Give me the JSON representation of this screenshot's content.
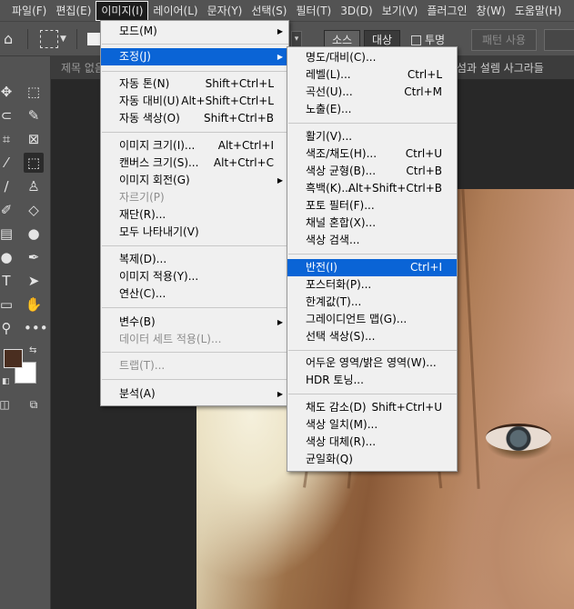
{
  "menubar": {
    "items": [
      "파일(F)",
      "편집(E)",
      "이미지(I)",
      "레이어(L)",
      "문자(Y)",
      "선택(S)",
      "필터(T)",
      "3D(D)",
      "보기(V)",
      "플러그인",
      "창(W)",
      "도움말(H)"
    ]
  },
  "options": {
    "seg1": "소스",
    "seg2": "대상",
    "transparent_label": "투명",
    "pattern_button": "패턴 사용"
  },
  "tabs": {
    "doc1": "제목 없음",
    "doc2": "의 낯섬과 설렘 사그라들"
  },
  "image_menu": {
    "mode": "모드(M)",
    "adjust": "조정(J)",
    "auto_tone": {
      "label": "자동 톤(N)",
      "shortcut": "Shift+Ctrl+L"
    },
    "auto_contrast": {
      "label": "자동 대비(U)",
      "shortcut": "Alt+Shift+Ctrl+L"
    },
    "auto_color": {
      "label": "자동 색상(O)",
      "shortcut": "Shift+Ctrl+B"
    },
    "image_size": {
      "label": "이미지 크기(I)...",
      "shortcut": "Alt+Ctrl+I"
    },
    "canvas_size": {
      "label": "캔버스 크기(S)...",
      "shortcut": "Alt+Ctrl+C"
    },
    "rotation": "이미지 회전(G)",
    "crop": "자르기(P)",
    "trim": "재단(R)...",
    "reveal_all": "모두 나타내기(V)",
    "duplicate": "복제(D)...",
    "apply_image": "이미지 적용(Y)...",
    "calculations": "연산(C)...",
    "variables": "변수(B)",
    "data_sets": "데이터 세트 적용(L)...",
    "trap": "트랩(T)...",
    "analysis": "분석(A)"
  },
  "adjust_menu": {
    "brightness": "명도/대비(C)...",
    "levels": {
      "label": "레벨(L)...",
      "shortcut": "Ctrl+L"
    },
    "curves": {
      "label": "곡선(U)...",
      "shortcut": "Ctrl+M"
    },
    "exposure": "노출(E)...",
    "vibrance": "활기(V)...",
    "hue_sat": {
      "label": "색조/채도(H)...",
      "shortcut": "Ctrl+U"
    },
    "color_balance": {
      "label": "색상 균형(B)...",
      "shortcut": "Ctrl+B"
    },
    "bw": {
      "label": "흑백(K)...",
      "shortcut": "Alt+Shift+Ctrl+B"
    },
    "photo_filter": "포토 필터(F)...",
    "channel_mixer": "채널 혼합(X)...",
    "color_lookup": "색상 검색...",
    "invert": {
      "label": "반전(I)",
      "shortcut": "Ctrl+I"
    },
    "posterize": "포스터화(P)...",
    "threshold": "한계값(T)...",
    "gradient_map": "그레이디언트 맵(G)...",
    "selective_color": "선택 색상(S)...",
    "shadows": "어두운 영역/밝은 영역(W)...",
    "hdr": "HDR 토닝...",
    "desaturate": {
      "label": "채도 감소(D)",
      "shortcut": "Shift+Ctrl+U"
    },
    "match_color": "색상 일치(M)...",
    "replace_color": "색상 대체(R)...",
    "equalize": "균일화(Q)"
  }
}
